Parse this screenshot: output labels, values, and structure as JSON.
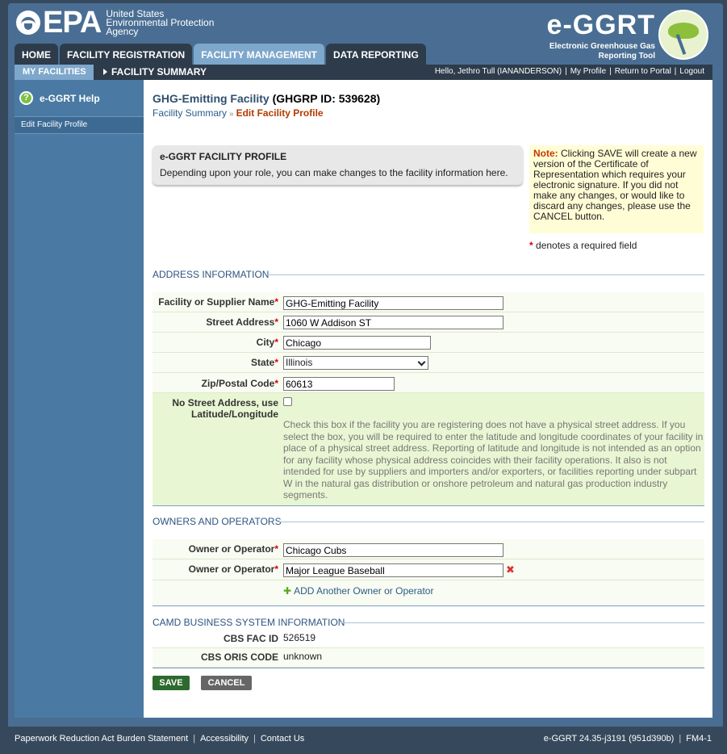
{
  "header": {
    "agency_line1": "United States",
    "agency_line2": "Environmental Protection",
    "agency_line3": "Agency",
    "epa_letters": "EPA",
    "tool_name": "e-GGRT",
    "tool_sub1": "Electronic Greenhouse Gas",
    "tool_sub2": "Reporting Tool",
    "tabs": [
      {
        "label": "HOME"
      },
      {
        "label": "FACILITY REGISTRATION"
      },
      {
        "label": "FACILITY MANAGEMENT"
      },
      {
        "label": "DATA REPORTING"
      }
    ]
  },
  "subnav": {
    "active": "MY FACILITIES",
    "link": "FACILITY SUMMARY",
    "greeting": "Hello, Jethro Tull (IANANDERSON)",
    "my_profile": "My Profile",
    "return_portal": "Return to Portal",
    "logout": "Logout"
  },
  "leftnav": {
    "help": "e-GGRT Help",
    "item": "Edit Facility Profile"
  },
  "page": {
    "facility_name": "GHG-Emitting Facility",
    "ghgrp_id": "(GHGRP ID: 539628)",
    "breadcrumb_link": "Facility Summary",
    "breadcrumb_sep": "»",
    "breadcrumb_current": "Edit Facility Profile"
  },
  "profile_box": {
    "title": "e-GGRT FACILITY PROFILE",
    "desc": "Depending upon your role, you can make changes to the facility information here."
  },
  "note": {
    "label": "Note:",
    "text": "Clicking SAVE will create a new version of the Certificate of Representation which requires your electronic signature. If you did not make any changes, or would like to discard any changes, please use the CANCEL button."
  },
  "required_note": {
    "star": "*",
    "text": "denotes a required field"
  },
  "address": {
    "heading": "ADDRESS INFORMATION",
    "name_label": "Facility or Supplier Name",
    "name_value": "GHG-Emitting Facility",
    "street_label": "Street Address",
    "street_value": "1060 W Addison ST",
    "city_label": "City",
    "city_value": "Chicago",
    "state_label": "State",
    "state_value": "Illinois",
    "zip_label": "Zip/Postal Code",
    "zip_value": "60613",
    "nostreet_label1": "No Street Address, use",
    "nostreet_label2": "Latitude/Longitude",
    "nostreet_checked": false,
    "nostreet_help": "Check this box if the facility you are registering does not have a physical street address. If you select the box, you will be required to enter the latitude and longitude coordinates of your facility in place of a physical street address. Reporting of latitude and longitude is not intended as an option for any facility whose physical address coincides with their facility operations. It also is not intended for use by suppliers and importers and/or exporters, or facilities reporting under subpart W in the natural gas distribution or onshore petroleum and natural gas production industry segments."
  },
  "owners": {
    "heading": "OWNERS AND OPERATORS",
    "owner_label": "Owner or Operator",
    "owner1_value": "Chicago Cubs",
    "owner2_value": "Major League Baseball",
    "add_label": "ADD Another Owner or Operator"
  },
  "camd": {
    "heading": "CAMD BUSINESS SYSTEM INFORMATION",
    "fac_id_label": "CBS FAC ID",
    "fac_id_value": "526519",
    "oris_label": "CBS ORIS CODE",
    "oris_value": "unknown"
  },
  "buttons": {
    "save": "SAVE",
    "cancel": "CANCEL"
  },
  "footer": {
    "paperwork": "Paperwork Reduction Act Burden Statement",
    "accessibility": "Accessibility",
    "contact": "Contact Us",
    "version": "e-GGRT 24.35-j3191 (951d390b)",
    "form_id": "FM4-1"
  },
  "colors": {
    "header_blue": "#4a6e93",
    "dark_nav": "#2d3b4a",
    "active_tab": "#7ea7cc",
    "save_green": "#2d6a2e",
    "required_red": "#dd0000"
  }
}
